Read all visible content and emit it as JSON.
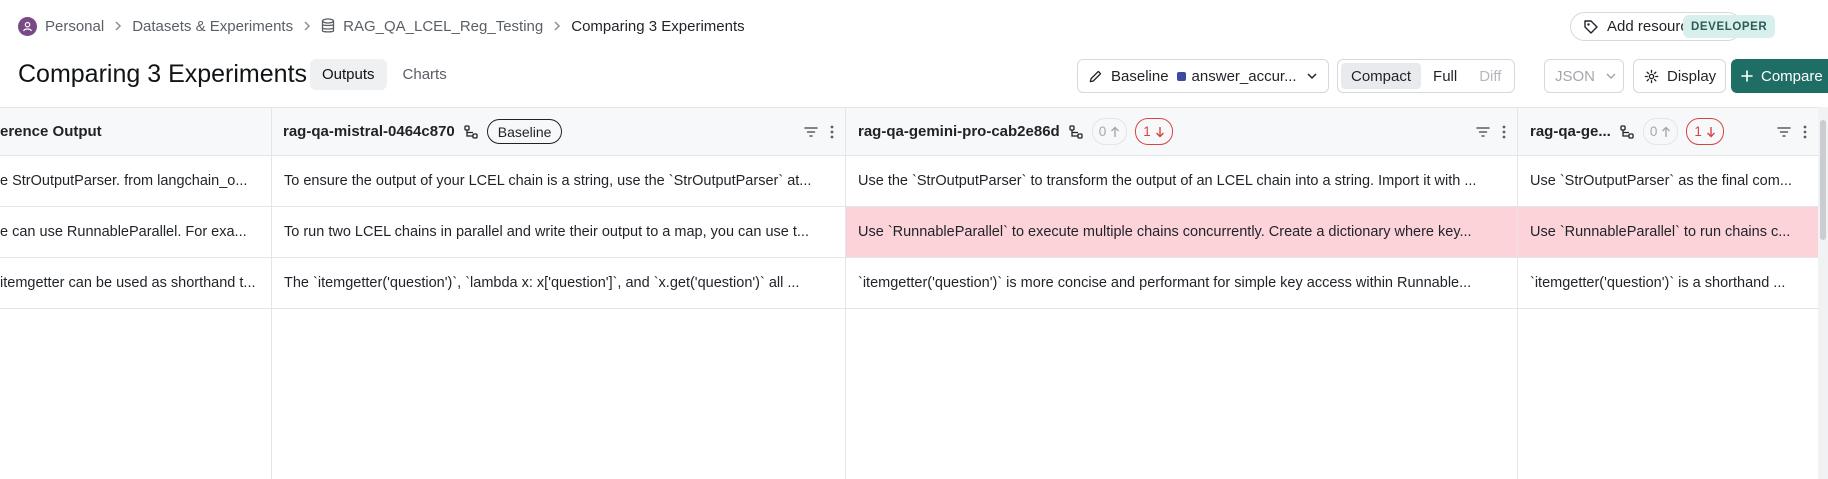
{
  "breadcrumb": {
    "items": [
      "Personal",
      "Datasets & Experiments",
      "RAG_QA_LCEL_Reg_Testing",
      "Comparing 3 Experiments"
    ]
  },
  "header": {
    "add_tags_label": "Add resource tags",
    "role_badge": "DEVELOPER"
  },
  "page": {
    "title": "Comparing 3 Experiments",
    "tabs": [
      "Outputs",
      "Charts"
    ],
    "active_tab": "Outputs"
  },
  "toolbar": {
    "baseline_label": "Baseline",
    "metric_label": "answer_accur...",
    "view_modes": [
      "Compact",
      "Full",
      "Diff"
    ],
    "active_view_mode": "Compact",
    "format_label": "JSON",
    "display_label": "Display",
    "compare_label": "Compare"
  },
  "colors": {
    "primary": "#1f6e66",
    "regression": "#d64545",
    "regression_bg": "#fcd3d8",
    "metric": "#3d4aa0"
  },
  "table": {
    "columns": [
      {
        "name": "erence Output",
        "kind": "reference"
      },
      {
        "name": "rag-qa-mistral-0464c870",
        "badge": "Baseline"
      },
      {
        "name": "rag-qa-gemini-pro-cab2e86d",
        "improved": "0",
        "regressed": "1"
      },
      {
        "name": "rag-qa-ge...",
        "improved": "0",
        "regressed": "1"
      }
    ],
    "rows": [
      {
        "reference": "e StrOutputParser. from langchain_o...",
        "mistral": "To ensure the output of your LCEL chain is a string, use the `StrOutputParser` at...",
        "gemini_pro": "Use the `StrOutputParser` to transform the output of an LCEL chain into a string. Import it with ...",
        "gemini_other": "Use `StrOutputParser` as the final com..."
      },
      {
        "reference": "e can use RunnableParallel. For exa...",
        "mistral": "To run two LCEL chains in parallel and write their output to a map, you can use t...",
        "gemini_pro": "Use `RunnableParallel` to execute multiple chains concurrently. Create a dictionary where key...",
        "gemini_other": "Use `RunnableParallel` to run chains c..."
      },
      {
        "reference": "itemgetter can be used as shorthand t...",
        "mistral": "The `itemgetter('question')`, `lambda x: x['question']`, and `x.get('question')` all ...",
        "gemini_pro": "`itemgetter('question')` is more concise and performant for simple key access within Runnable...",
        "gemini_other": "`itemgetter('question')` is a shorthand ..."
      }
    ]
  }
}
